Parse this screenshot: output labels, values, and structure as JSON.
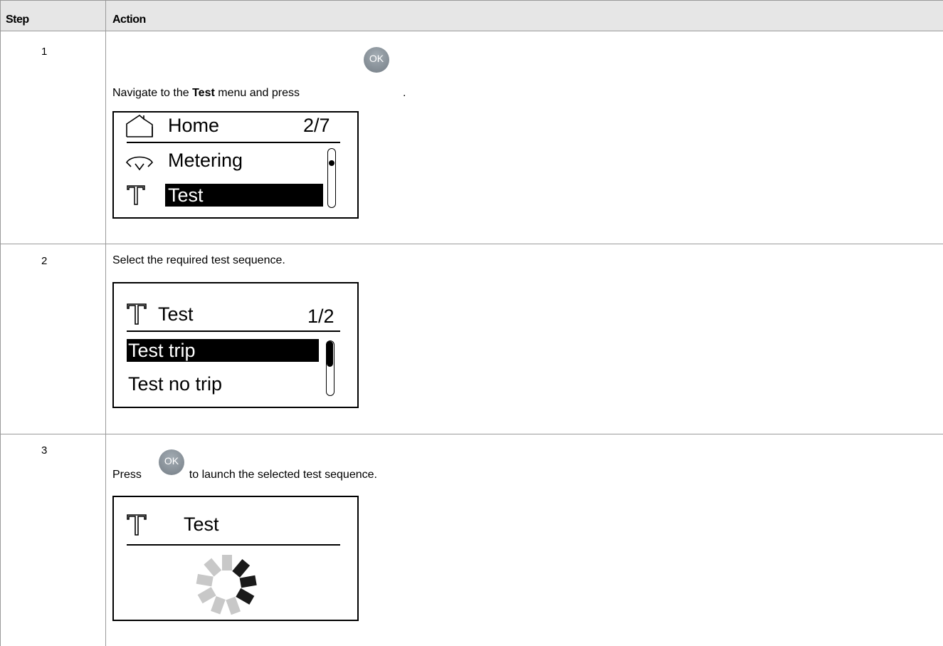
{
  "table": {
    "headers": {
      "step": "Step",
      "action": "Action"
    }
  },
  "rows": [
    {
      "step": "1",
      "text_before": "Navigate to the ",
      "text_bold": "Test",
      "text_after": " menu and press ",
      "text_end": ".",
      "button": "OK",
      "screen": {
        "title": "Home",
        "page": "2/7",
        "items": [
          "Metering",
          "Test"
        ],
        "icons": [
          "home-icon",
          "gauge-icon",
          "test-icon"
        ]
      }
    },
    {
      "step": "2",
      "text": "Select the required test sequence.",
      "screen": {
        "title": "Test",
        "page": "1/2",
        "items": [
          "Test trip",
          "Test no trip"
        ],
        "icons": [
          "test-icon"
        ]
      }
    },
    {
      "step": "3",
      "text_before": "Press ",
      "text_after": " to launch the selected test sequence.",
      "button": "OK",
      "screen": {
        "title": "Test",
        "icons": [
          "test-icon",
          "loading-spinner-icon"
        ]
      }
    }
  ]
}
